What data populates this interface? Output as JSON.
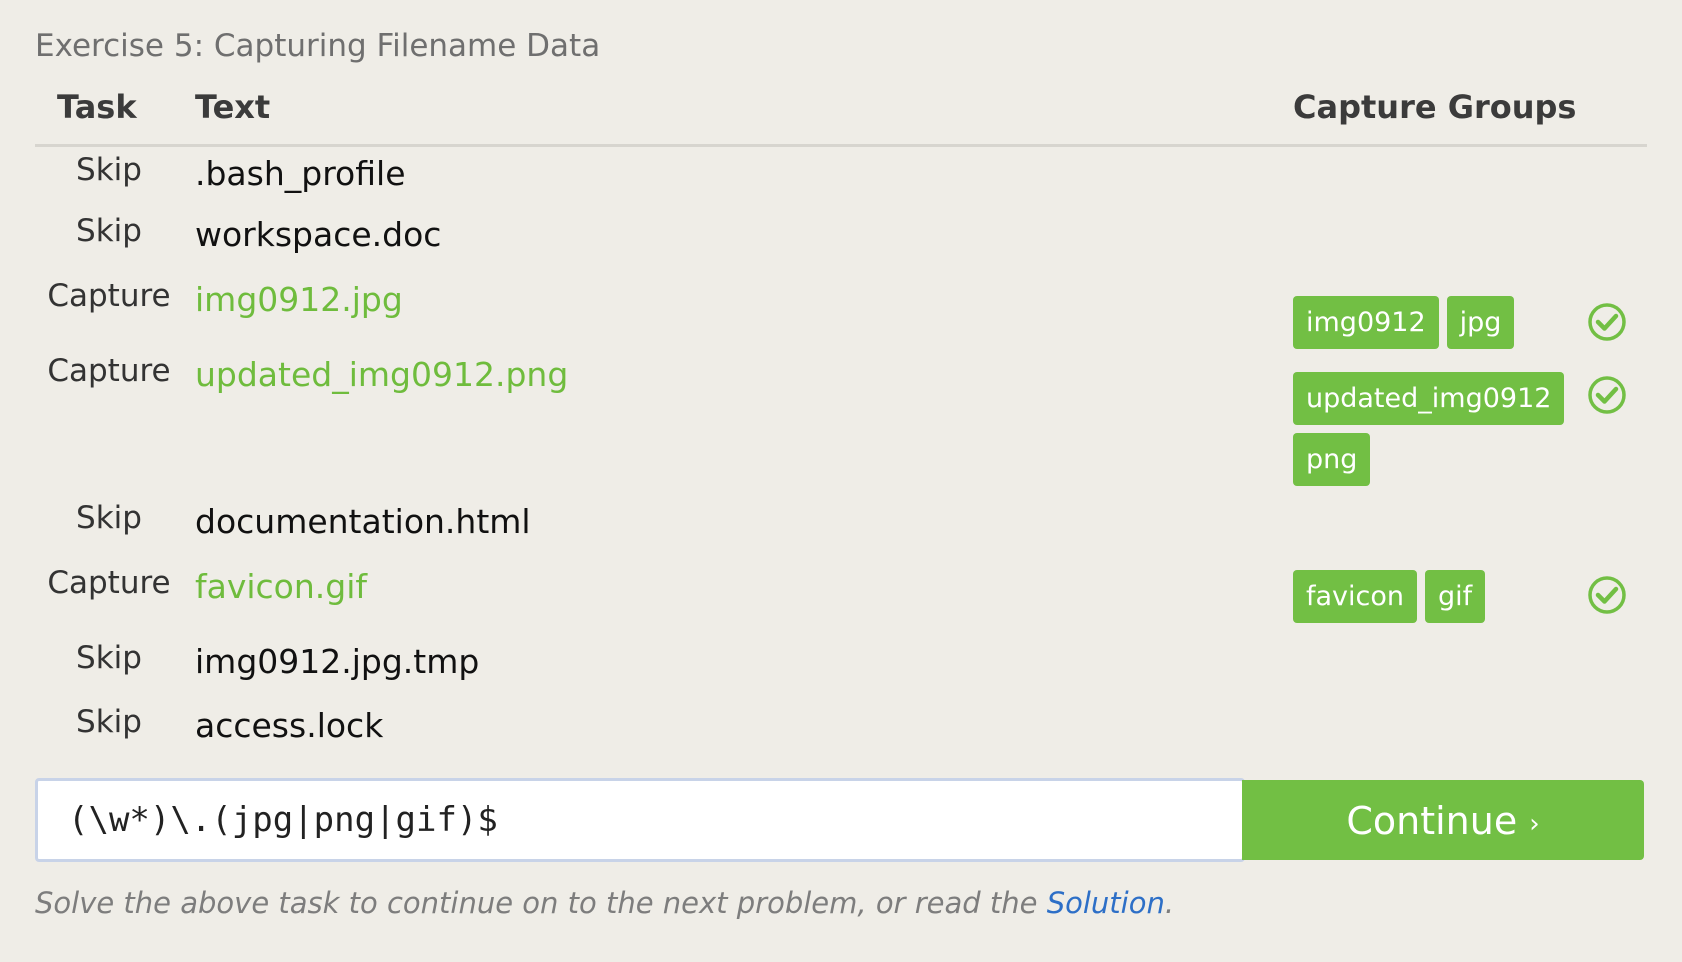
{
  "exercise": {
    "title": "Exercise 5: Capturing Filename Data",
    "headers": {
      "task": "Task",
      "text": "Text",
      "groups": "Capture Groups"
    },
    "rows": [
      {
        "task": "Skip",
        "text": ".bash_profile",
        "groups": [],
        "solved": false
      },
      {
        "task": "Skip",
        "text": "workspace.doc",
        "groups": [],
        "solved": false
      },
      {
        "task": "Capture",
        "text": "img0912.jpg",
        "groups": [
          "img0912",
          "jpg"
        ],
        "solved": true
      },
      {
        "task": "Capture",
        "text": "updated_img0912.png",
        "groups": [
          "updated_img0912",
          "png"
        ],
        "solved": true
      },
      {
        "task": "Skip",
        "text": "documentation.html",
        "groups": [],
        "solved": false
      },
      {
        "task": "Capture",
        "text": "favicon.gif",
        "groups": [
          "favicon",
          "gif"
        ],
        "solved": true
      },
      {
        "task": "Skip",
        "text": "img0912.jpg.tmp",
        "groups": [],
        "solved": false
      },
      {
        "task": "Skip",
        "text": "access.lock",
        "groups": [],
        "solved": false
      }
    ],
    "input_value": "(\\w*)\\.(jpg|png|gif)$",
    "continue_label": "Continue",
    "continue_icon": "›",
    "hint_prefix": "Solve the above task to continue on to the next problem, or read the ",
    "hint_link": "Solution",
    "hint_suffix": "."
  },
  "colors": {
    "background": "#efede7",
    "accent_green": "#72bf44",
    "capture_text": "#6fbc3d",
    "link_blue": "#2d6fc7"
  },
  "icons": {
    "solved": "check-circle-icon"
  }
}
